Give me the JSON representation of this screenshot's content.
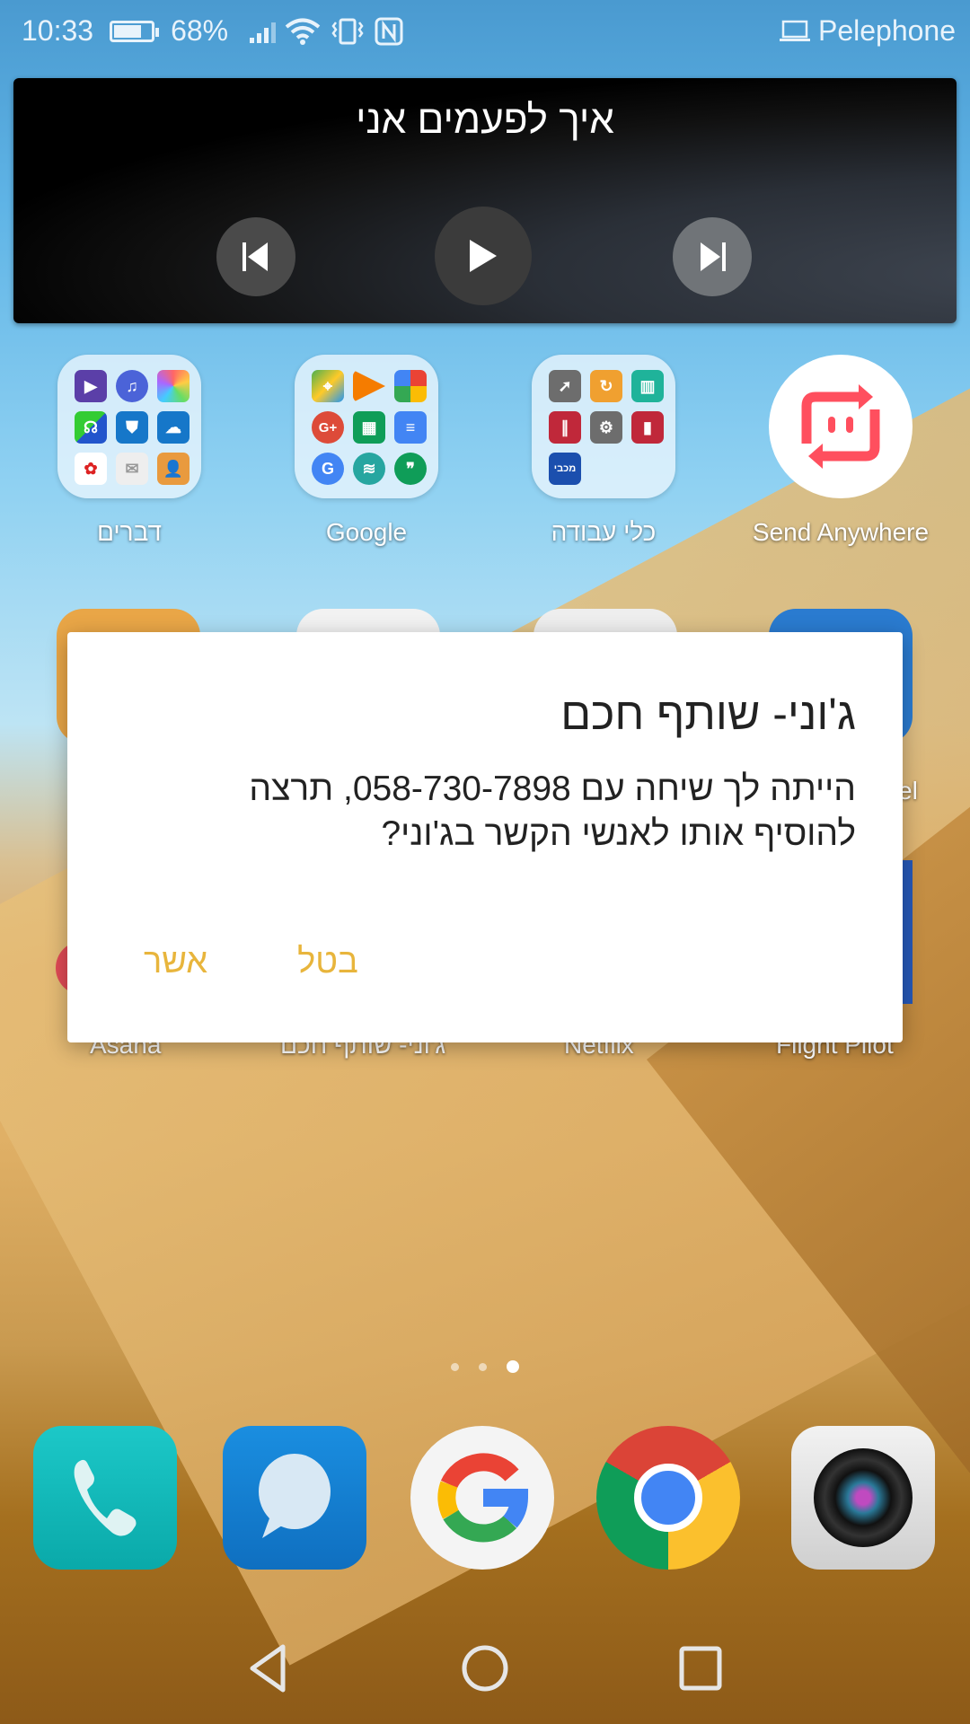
{
  "status_bar": {
    "time": "10:33",
    "battery_percent": "68%",
    "carrier": "Pelephone",
    "icons": [
      "battery-icon",
      "signal-icon",
      "wifi-icon",
      "vibrate-icon",
      "nfc-icon",
      "laptop-icon"
    ]
  },
  "music_widget": {
    "track_title": "איך לפעמים אני",
    "controls": [
      "previous",
      "play",
      "next"
    ]
  },
  "home_apps_row1": [
    {
      "label": "דברים",
      "type": "folder",
      "apps": [
        "video",
        "music",
        "gallery",
        "support",
        "phone-manager",
        "weather",
        "huawei",
        "email",
        "contacts"
      ]
    },
    {
      "label": "Google",
      "type": "folder",
      "apps": [
        "maps",
        "play-music",
        "photos",
        "google-plus",
        "sheets",
        "docs",
        "google",
        "swiftkey",
        "hangouts"
      ]
    },
    {
      "label": "כלי עבודה",
      "type": "folder",
      "apps": [
        "compass",
        "backup",
        "sim-toolkit",
        "recorder",
        "settings",
        "flashlight",
        "maccabi"
      ]
    },
    {
      "label": "Send Anywhere",
      "type": "app"
    }
  ],
  "home_apps_row2_labels": [
    "Asana",
    "ג'וני- שותף חכם",
    "Netflix",
    "Flight Pilot"
  ],
  "row2_partial_label": "el",
  "dialog": {
    "title": "ג'וני- שותף חכם",
    "message": "הייתה לך שיחה עם 058-730-7898, תרצה להוסיף אותו לאנשי הקשר בג'וני?",
    "confirm_label": "אשר",
    "cancel_label": "בטל",
    "button_color": "#e8b53c"
  },
  "page_indicator": {
    "pages": 3,
    "active": 3
  },
  "dock": [
    "Phone",
    "Messages",
    "Google",
    "Chrome",
    "Camera"
  ],
  "nav_bar": [
    "back",
    "home",
    "recents"
  ]
}
